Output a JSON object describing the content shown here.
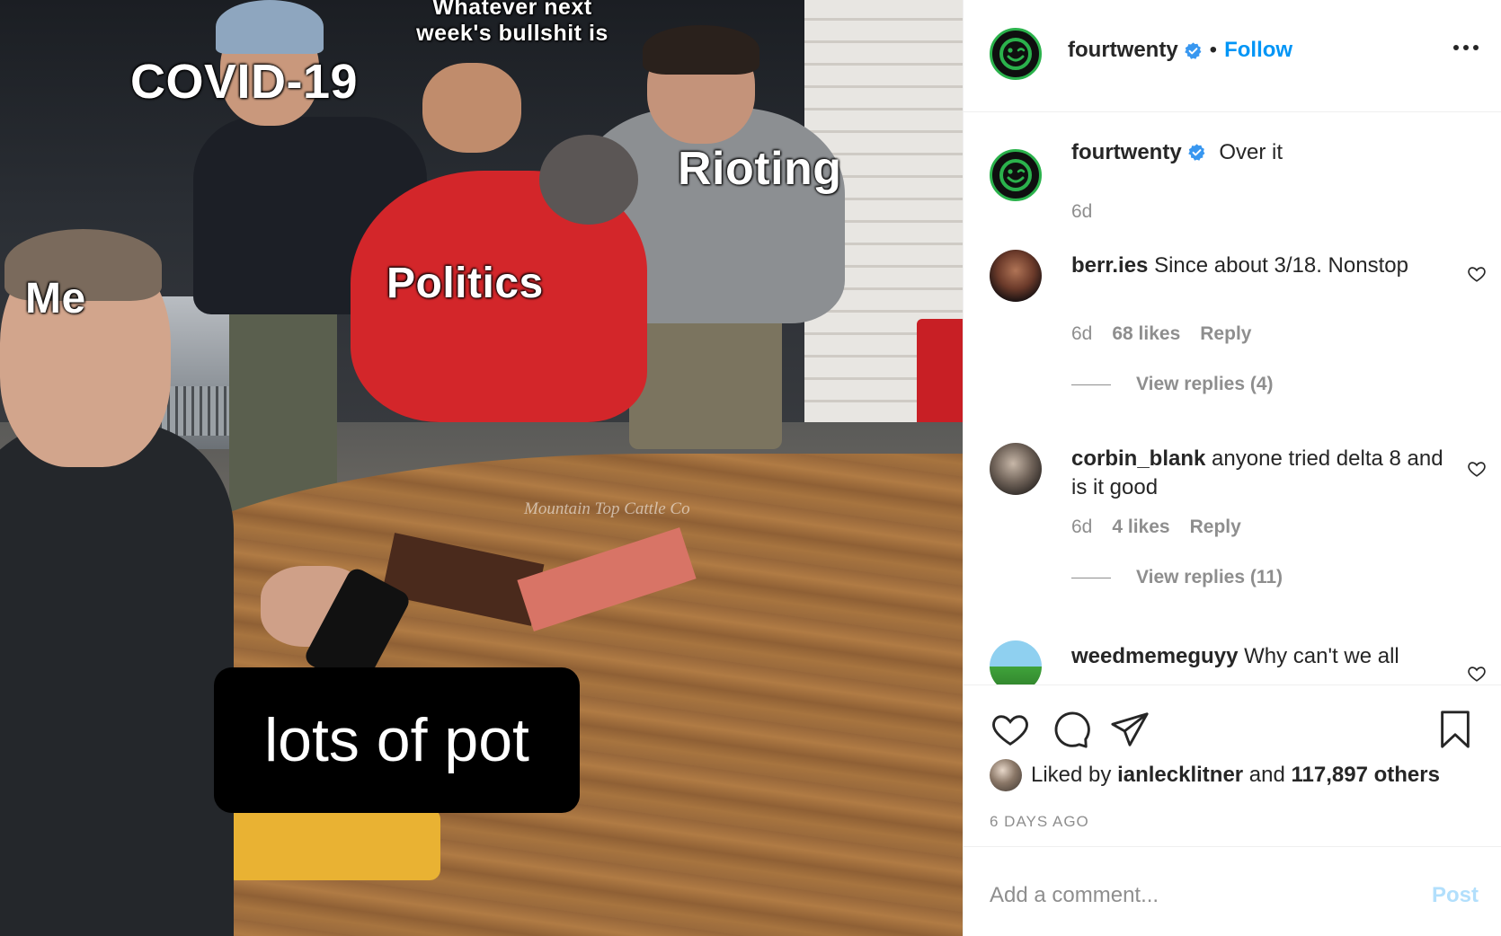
{
  "post_image": {
    "labels": {
      "whatever": "Whatever next week's bullshit is",
      "covid": "COVID-19",
      "rioting": "Rioting",
      "politics": "Politics",
      "me": "Me",
      "pot": "lots of pot"
    },
    "watermark": "Mountain Top Cattle Co"
  },
  "header": {
    "username": "fourtwenty",
    "separator": "•",
    "follow_label": "Follow"
  },
  "caption": {
    "username": "fourtwenty",
    "text": "Over it",
    "time": "6d"
  },
  "comments": [
    {
      "username": "berr.ies",
      "text": "Since about 3/18. Nonstop",
      "time": "6d",
      "likes": "68 likes",
      "reply_label": "Reply",
      "view_replies": "View replies (4)"
    },
    {
      "username": "corbin_blank",
      "text": "anyone tried delta 8 and is it good",
      "time": "6d",
      "likes": "4 likes",
      "reply_label": "Reply",
      "view_replies": "View replies (11)"
    },
    {
      "username": "weedmemeguyy",
      "text": "Why can't we all"
    }
  ],
  "actions": {
    "icons": [
      "heart-icon",
      "comment-icon",
      "share-icon",
      "bookmark-icon"
    ],
    "liked_prefix": "Liked by",
    "liked_user": "ianlecklitner",
    "liked_and": "and",
    "liked_others": "117,897 others",
    "date": "6 DAYS AGO"
  },
  "add_comment": {
    "placeholder": "Add a comment...",
    "post_label": "Post"
  },
  "colors": {
    "accent": "#0095f6",
    "brand_green": "#2bb24c",
    "meta_gray": "#8e8e8e",
    "post_disabled": "#b2dffc"
  }
}
